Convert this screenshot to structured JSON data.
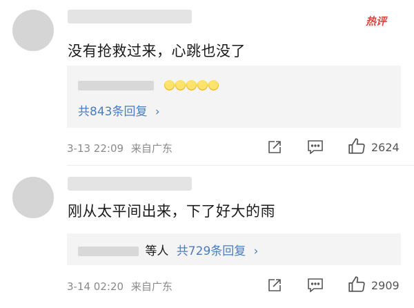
{
  "hot_badge": "热评",
  "comments": [
    {
      "text": "没有抢救过来，心跳也没了",
      "reply_summary": "共843条回复",
      "chevron": "›",
      "date": "3-13 22:09",
      "location": "来自广东",
      "likes": "2624"
    },
    {
      "text": "刚从太平间出来，下了好大的雨",
      "reply_suffix": "等人",
      "reply_summary": "共729条回复",
      "chevron": "›",
      "date": "3-14 02:20",
      "location": "来自广东",
      "likes": "2909"
    }
  ],
  "colors": {
    "accent_link": "#4a7cc0",
    "hot_badge": "#e0453a",
    "meta_text": "#8a8a8a",
    "reply_bg": "#f4f4f4"
  },
  "icons": {
    "share": "share-icon",
    "comment": "comment-icon",
    "like": "thumbs-up-icon",
    "chevron": "chevron-right-icon",
    "emoji": "crying-face-emoji"
  }
}
